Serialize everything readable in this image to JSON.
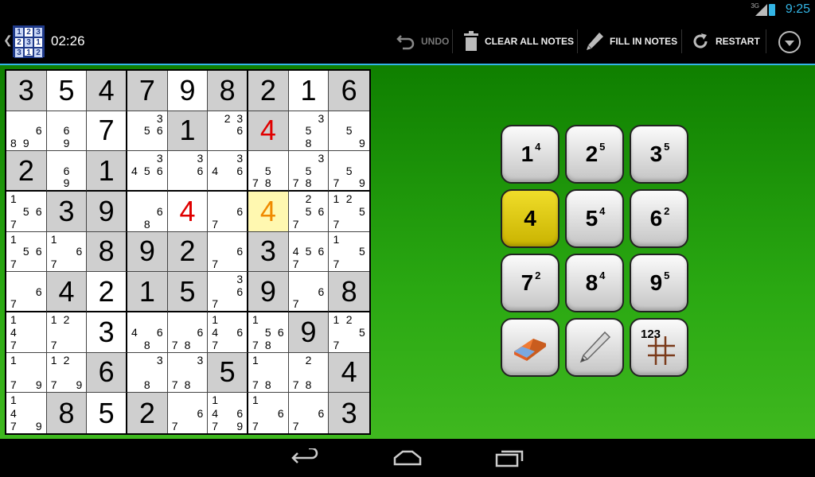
{
  "status": {
    "time": "9:25",
    "network": "3G"
  },
  "actionbar": {
    "logo_digits": [
      "1",
      "2",
      "3",
      "2",
      "3",
      "1",
      "3",
      "1",
      "2"
    ],
    "timer": "02:26",
    "undo_label": "UNDO",
    "clear_label": "CLEAR ALL NOTES",
    "fill_label": "FILL IN NOTES",
    "restart_label": "RESTART"
  },
  "board": {
    "cells": [
      [
        {
          "v": "3",
          "given": true
        },
        {
          "v": "5"
        },
        {
          "v": "4",
          "given": true
        },
        {
          "v": "7",
          "given": true
        },
        {
          "v": "9"
        },
        {
          "v": "8",
          "given": true
        },
        {
          "v": "2",
          "given": true
        },
        {
          "v": "1"
        },
        {
          "v": "6",
          "given": true
        }
      ],
      [
        {
          "n": [
            "",
            "",
            "",
            "",
            "",
            "6",
            "8",
            "9",
            ""
          ]
        },
        {
          "n": [
            "",
            "",
            "",
            "",
            "6",
            "",
            "",
            "9",
            ""
          ]
        },
        {
          "v": "7"
        },
        {
          "n": [
            "",
            "",
            "3",
            "",
            "5",
            "6",
            "",
            "",
            ""
          ]
        },
        {
          "v": "1",
          "given": true
        },
        {
          "n": [
            "",
            "2",
            "3",
            "",
            "",
            "6",
            "",
            "",
            ""
          ]
        },
        {
          "v": "4",
          "given": true,
          "red": true
        },
        {
          "n": [
            "",
            "",
            "3",
            "",
            "5",
            "",
            "",
            "8",
            ""
          ]
        },
        {
          "n": [
            "",
            "",
            "",
            "",
            "5",
            "",
            "",
            "",
            "9"
          ]
        }
      ],
      [
        {
          "v": "2",
          "given": true
        },
        {
          "n": [
            "",
            "",
            "",
            "",
            "6",
            "",
            "",
            "9",
            ""
          ]
        },
        {
          "v": "1",
          "given": true
        },
        {
          "n": [
            "",
            "",
            "3",
            "4",
            "5",
            "6",
            "",
            "",
            ""
          ]
        },
        {
          "n": [
            "",
            "",
            "3",
            "",
            "",
            "6",
            "",
            "",
            ""
          ]
        },
        {
          "n": [
            "",
            "",
            "3",
            "4",
            "",
            "6",
            "",
            "",
            ""
          ]
        },
        {
          "n": [
            "",
            "",
            "",
            "",
            "5",
            "",
            "7",
            "8",
            ""
          ]
        },
        {
          "n": [
            "",
            "",
            "3",
            "",
            "5",
            "",
            "7",
            "8",
            ""
          ]
        },
        {
          "n": [
            "",
            "",
            "",
            "",
            "5",
            "",
            "7",
            "",
            "9"
          ]
        }
      ],
      [
        {
          "n": [
            "1",
            "",
            "",
            "",
            "5",
            "6",
            "7",
            "",
            ""
          ]
        },
        {
          "v": "3",
          "given": true
        },
        {
          "v": "9",
          "given": true
        },
        {
          "n": [
            "",
            "",
            "",
            "",
            "",
            "6",
            "",
            "8",
            ""
          ]
        },
        {
          "v": "4",
          "red": true
        },
        {
          "n": [
            "",
            "",
            "",
            "",
            "",
            "6",
            "7",
            "",
            ""
          ]
        },
        {
          "v": "4",
          "sel": true
        },
        {
          "n": [
            "",
            "2",
            "",
            "",
            "5",
            "6",
            "7",
            "",
            ""
          ]
        },
        {
          "n": [
            "1",
            "2",
            "",
            "",
            "",
            "5",
            "7",
            "",
            ""
          ]
        }
      ],
      [
        {
          "n": [
            "1",
            "",
            "",
            "",
            "5",
            "6",
            "7",
            "",
            ""
          ]
        },
        {
          "n": [
            "1",
            "",
            "",
            "",
            "",
            "6",
            "7",
            "",
            ""
          ]
        },
        {
          "v": "8",
          "given": true
        },
        {
          "v": "9",
          "given": true
        },
        {
          "v": "2",
          "given": true
        },
        {
          "n": [
            "",
            "",
            "",
            "",
            "",
            "6",
            "7",
            "",
            ""
          ]
        },
        {
          "v": "3",
          "given": true
        },
        {
          "n": [
            "",
            "",
            "",
            "4",
            "5",
            "6",
            "7",
            "",
            ""
          ]
        },
        {
          "n": [
            "1",
            "",
            "",
            "",
            "",
            "5",
            "7",
            "",
            ""
          ]
        }
      ],
      [
        {
          "n": [
            "",
            "",
            "",
            "",
            "",
            "6",
            "7",
            "",
            ""
          ]
        },
        {
          "v": "4",
          "given": true
        },
        {
          "v": "2"
        },
        {
          "v": "1",
          "given": true
        },
        {
          "v": "5",
          "given": true
        },
        {
          "n": [
            "",
            "",
            "3",
            "",
            "",
            "6",
            "7",
            "",
            ""
          ]
        },
        {
          "v": "9",
          "given": true
        },
        {
          "n": [
            "",
            "",
            "",
            "",
            "",
            "6",
            "7",
            "",
            ""
          ]
        },
        {
          "v": "8",
          "given": true
        }
      ],
      [
        {
          "n": [
            "1",
            "",
            "",
            "4",
            "",
            "",
            "7",
            "",
            ""
          ]
        },
        {
          "n": [
            "1",
            "2",
            "",
            "",
            "",
            "",
            "7",
            "",
            ""
          ]
        },
        {
          "v": "3"
        },
        {
          "n": [
            "",
            "",
            "",
            "4",
            "",
            "6",
            "",
            "8",
            ""
          ]
        },
        {
          "n": [
            "",
            "",
            "",
            "",
            "",
            "6",
            "7",
            "8",
            ""
          ]
        },
        {
          "n": [
            "1",
            "",
            "",
            "4",
            "",
            "6",
            "7",
            "",
            ""
          ]
        },
        {
          "n": [
            "1",
            "",
            "",
            "",
            "5",
            "6",
            "7",
            "8",
            ""
          ]
        },
        {
          "v": "9",
          "given": true
        },
        {
          "n": [
            "1",
            "2",
            "",
            "",
            "",
            "5",
            "7",
            "",
            ""
          ]
        }
      ],
      [
        {
          "n": [
            "1",
            "",
            "",
            "",
            "",
            "",
            "7",
            "",
            "9"
          ]
        },
        {
          "n": [
            "1",
            "2",
            "",
            "",
            "",
            "",
            "7",
            "",
            "9"
          ]
        },
        {
          "v": "6",
          "given": true
        },
        {
          "n": [
            "",
            "",
            "3",
            "",
            "",
            "",
            "",
            "8",
            ""
          ]
        },
        {
          "n": [
            "",
            "",
            "3",
            "",
            "",
            "",
            "7",
            "8",
            ""
          ]
        },
        {
          "v": "5",
          "given": true
        },
        {
          "n": [
            "1",
            "",
            "",
            "",
            "",
            "",
            "7",
            "8",
            ""
          ]
        },
        {
          "n": [
            "",
            "2",
            "",
            "",
            "",
            "",
            "7",
            "8",
            ""
          ]
        },
        {
          "v": "4",
          "given": true
        }
      ],
      [
        {
          "n": [
            "1",
            "",
            "",
            "4",
            "",
            "",
            "7",
            "",
            "9"
          ]
        },
        {
          "v": "8",
          "given": true
        },
        {
          "v": "5"
        },
        {
          "v": "2",
          "given": true
        },
        {
          "n": [
            "",
            "",
            "",
            "",
            "",
            "6",
            "7",
            "",
            ""
          ]
        },
        {
          "n": [
            "1",
            "",
            "",
            "4",
            "",
            "6",
            "7",
            "",
            "9"
          ]
        },
        {
          "n": [
            "1",
            "",
            "",
            "",
            "",
            "6",
            "7",
            "",
            ""
          ]
        },
        {
          "n": [
            "",
            "",
            "",
            "",
            "",
            "6",
            "7",
            "",
            ""
          ]
        },
        {
          "v": "3",
          "given": true
        }
      ]
    ]
  },
  "keypad": [
    {
      "num": "1",
      "count": "4"
    },
    {
      "num": "2",
      "count": "5"
    },
    {
      "num": "3",
      "count": "5"
    },
    {
      "num": "4",
      "count": "",
      "active": true
    },
    {
      "num": "5",
      "count": "4"
    },
    {
      "num": "6",
      "count": "2"
    },
    {
      "num": "7",
      "count": "2"
    },
    {
      "num": "8",
      "count": "4"
    },
    {
      "num": "9",
      "count": "5"
    }
  ],
  "tools": {
    "notes_grid_label": "123"
  }
}
